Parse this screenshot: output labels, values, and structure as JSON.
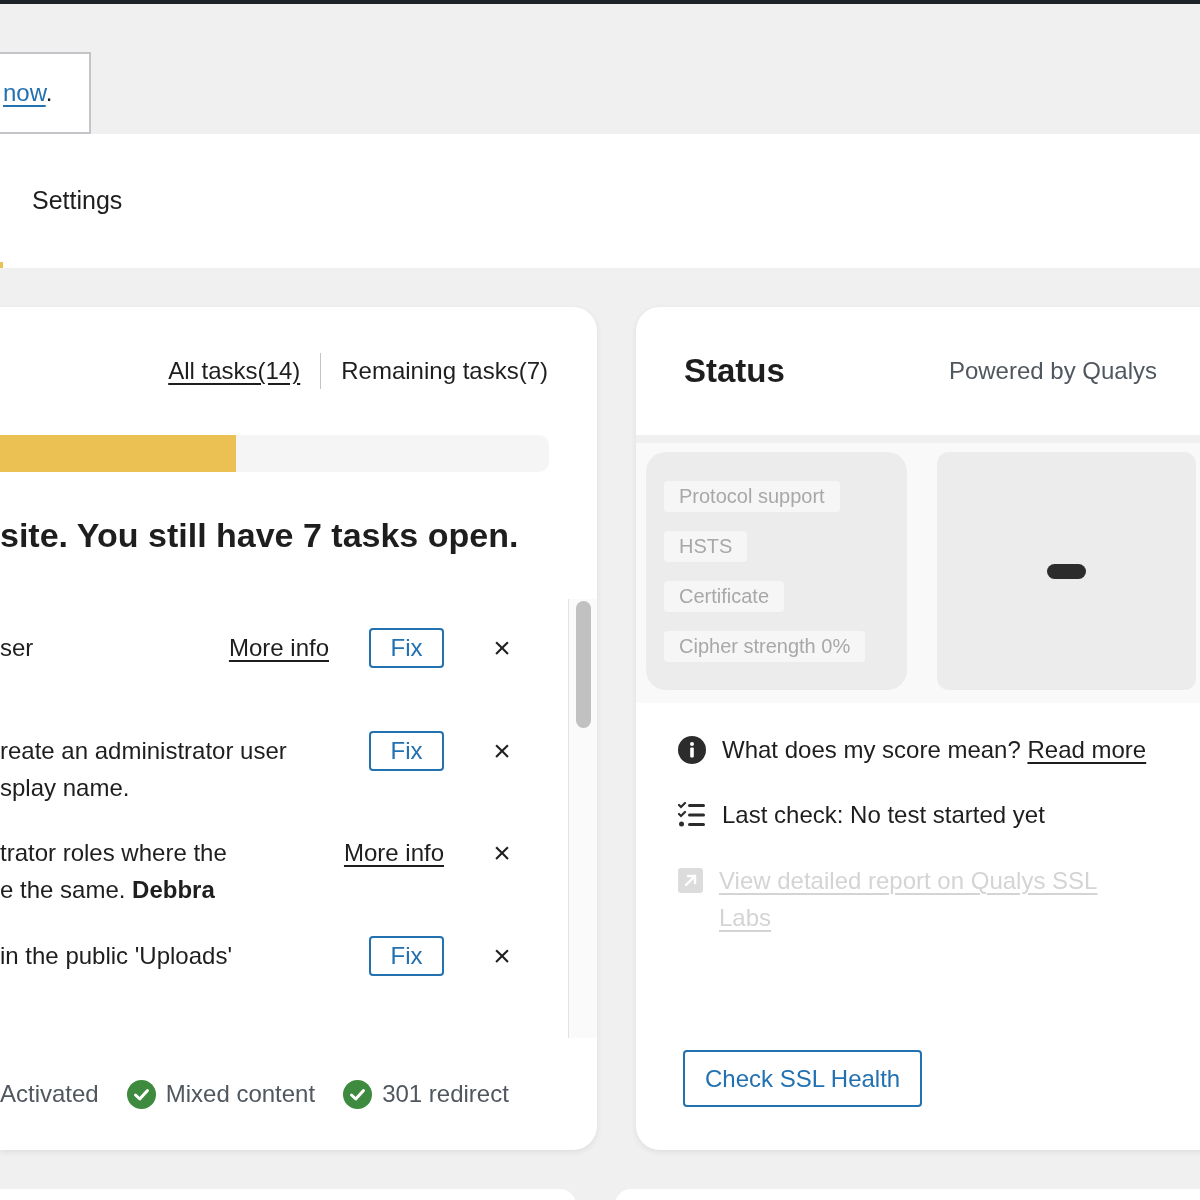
{
  "notice": {
    "link": "now",
    "text_after": "."
  },
  "tabs": [
    {
      "kind": "cut_off",
      "selected": true
    },
    {
      "kind": "labelled",
      "label": "Settings",
      "selected": false
    }
  ],
  "progress_card": {
    "filters": [
      {
        "label": "All tasks(14)",
        "selected": true
      },
      {
        "label": "Remaining tasks(7)",
        "selected": false
      }
    ],
    "progress": {
      "level": 0.43
    },
    "headline": "site. You still have 7 tasks open.",
    "tasks": [
      {
        "lines": [
          "ser"
        ],
        "more_info": "More info",
        "fix": "Fix",
        "dismiss": "×"
      },
      {
        "lines": [
          "reate an administrator user",
          "splay name."
        ],
        "fix": "Fix",
        "dismiss": "×"
      },
      {
        "lines": [
          "trator roles where the",
          "e the same. **Debbra**"
        ],
        "more_info": "More info",
        "dismiss": "×"
      },
      {
        "lines": [
          "in the public 'Uploads'"
        ],
        "fix": "Fix",
        "dismiss": "×"
      }
    ],
    "footer": [
      {
        "kind": "plain",
        "label": "Activated"
      },
      {
        "kind": "check",
        "label": "Mixed content"
      },
      {
        "kind": "check",
        "label": "301 redirect"
      }
    ]
  },
  "status_card": {
    "title": "Status",
    "powered_by": "Powered by Qualys",
    "breakdown": [
      "Protocol support",
      "HSTS",
      "Certificate",
      "Cipher strength 0%"
    ],
    "score": {
      "kind": "pending"
    },
    "info": {
      "text": "What does my score mean?",
      "link": "Read more"
    },
    "last_check": "Last check: No test started yet",
    "report_link": {
      "label": "View detailed report on Qualys SSL Labs",
      "disabled": true
    },
    "button": "Check SSL Health"
  }
}
